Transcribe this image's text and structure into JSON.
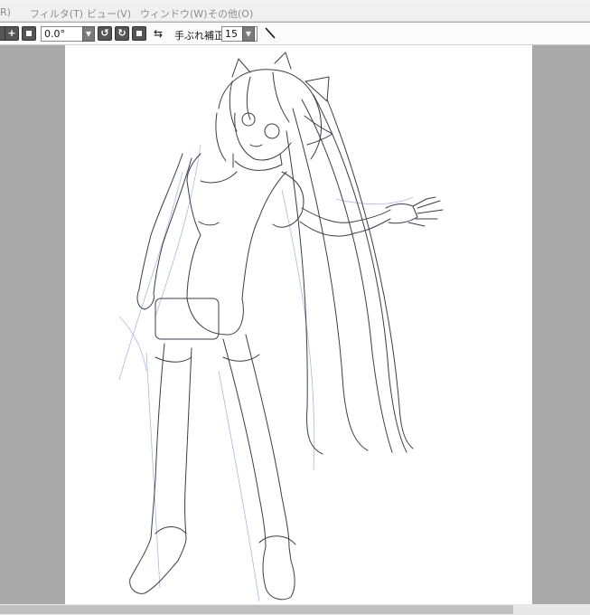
{
  "menu": {
    "items": [
      {
        "label": "R)"
      },
      {
        "label": "フィルタ(T)"
      },
      {
        "label": "ビュー(V)"
      },
      {
        "label": "ウィンドウ(W)"
      },
      {
        "label": "その他(O)"
      }
    ]
  },
  "toolbar": {
    "zoom_in_icon": "plus-icon",
    "stop_icon": "square-icon",
    "rotation_value": "0.0°",
    "rotate_ccw_icon": "rotate-left-icon",
    "rotate_cw_icon": "rotate-right-icon",
    "reset_icon": "square-icon",
    "flip_icon": "swap-arrows-icon",
    "stabilizer_label": "手ぶれ補正",
    "stabilizer_value": "15",
    "pen_icon": "line-pen-icon"
  },
  "colors": {
    "workspace": "#a9a9a9",
    "canvas": "#ffffff",
    "sketch_line": "#3d3d4a",
    "sketch_guide": "#9aa6d8"
  }
}
